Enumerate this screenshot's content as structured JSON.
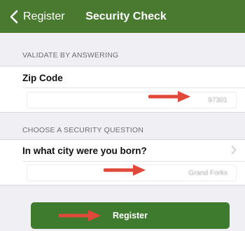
{
  "navbar": {
    "back_label": "Register",
    "title": "Security Check",
    "background": "#4a7a30"
  },
  "section1": {
    "header": "VALIDATE BY ANSWERING",
    "zip_label": "Zip Code",
    "zip_value": "97301"
  },
  "section2": {
    "header": "CHOOSE A SECURITY QUESTION",
    "question_label": "In what city were you born?",
    "answer_value": "Grand Forks"
  },
  "register_button": {
    "label": "Register",
    "color": "#3f7b2e"
  },
  "annotations": {
    "arrow_color": "#e0483a",
    "arrow_icon": "red-arrow-right"
  }
}
